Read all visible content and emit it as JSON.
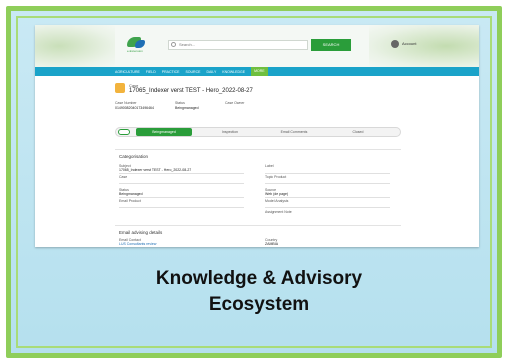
{
  "caption": {
    "line1": "Knowledge & Advisory",
    "line2": "Ecosystem"
  },
  "screenshot": {
    "logo_text": "e-Extension",
    "search_placeholder": "Search...",
    "search_button": "SEARCH",
    "user_name": "Account",
    "nav": [
      "AGRICULTURE",
      "FIELD",
      "PRACTICE",
      "SOURCE",
      "DAILY",
      "KNOWLEDGE",
      "MORE"
    ],
    "record_type": "Case",
    "record_title": "17065_Indexer verst TEST - Hero_2022-08-27",
    "fields": {
      "number_label": "Case Number",
      "number_value": "01490082040173496464",
      "status_label": "Status",
      "status_value": "Beingmanaged",
      "owner_label": "Case Owner"
    },
    "steps": [
      "Beingmanaged",
      "Inspection",
      "Email Comments",
      "Closed"
    ],
    "section1": {
      "title": "Categorisation",
      "left": [
        "Subject",
        "Case",
        "Status",
        "Email Product"
      ],
      "right": [
        "Label",
        "Topic Product",
        "Source",
        "Model Analysis",
        "Assignment Note"
      ],
      "subject_value": "17065_Indexer verst TEST - Hero_2022-08-27",
      "status_value": "Beingmanaged",
      "source_value": "Web (de page)"
    },
    "section2": {
      "title": "Email advising details",
      "left": [
        "Email Contact",
        "Account"
      ],
      "right": [
        "Country",
        "Province"
      ],
      "contact_value": "LUS Consultants review",
      "country_value": "ZAMBIA",
      "province_value": "LUS AKA Mik ZAMBIA"
    }
  }
}
